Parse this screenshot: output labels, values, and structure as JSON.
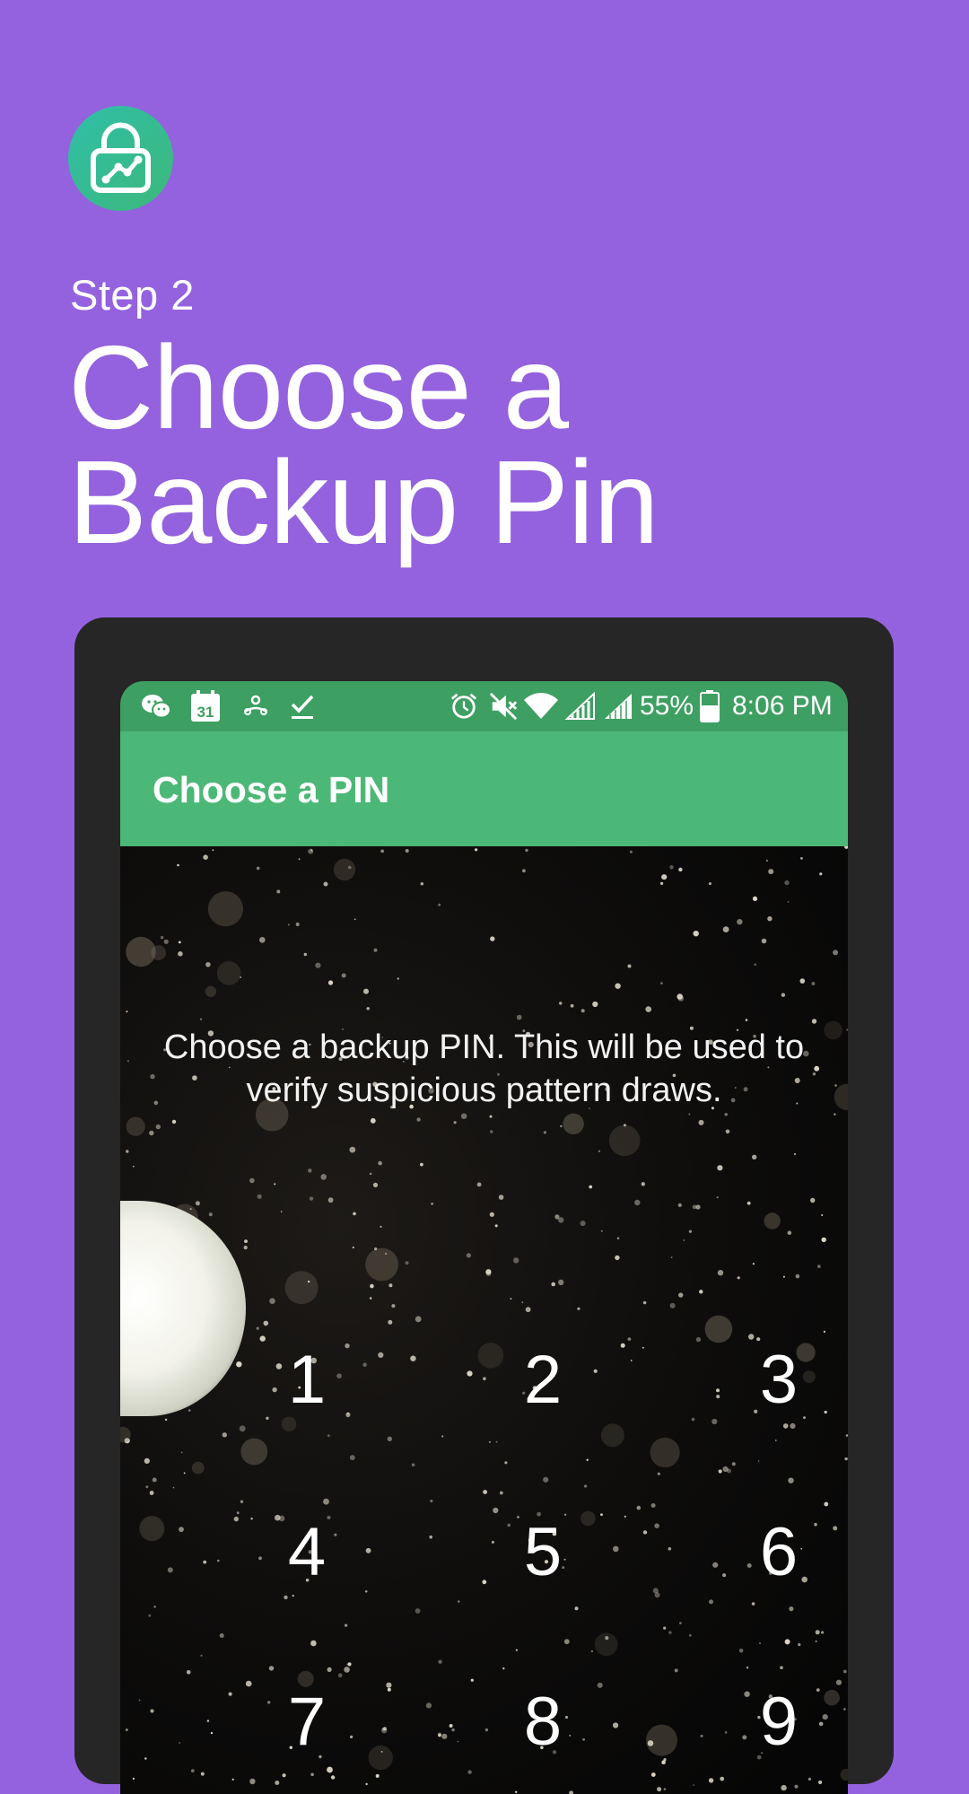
{
  "promo": {
    "step_label": "Step 2",
    "headline_line1": "Choose a",
    "headline_line2": "Backup Pin",
    "logo_icon": "lock-pattern-icon",
    "background_color": "#9462DE",
    "logo_gradient": [
      "#2FBFA8",
      "#3DB87A"
    ]
  },
  "status_bar": {
    "left_icons": [
      "wechat-icon",
      "calendar-icon",
      "cloud-sync-icon",
      "checkmark-icon"
    ],
    "calendar_day": "31",
    "right_icons": [
      "alarm-icon",
      "mute-icon",
      "wifi-icon",
      "signal-icon",
      "signal-icon",
      "battery-icon"
    ],
    "battery": "55%",
    "time": "8:06 PM",
    "color": "#3E9F62"
  },
  "app_bar": {
    "title": "Choose a PIN",
    "color": "#4CB877"
  },
  "main": {
    "instructions": "Choose a backup PIN. This will be used to verify suspicious pattern draws.",
    "keypad": [
      "1",
      "2",
      "3",
      "4",
      "5",
      "6",
      "7",
      "8",
      "9"
    ]
  }
}
